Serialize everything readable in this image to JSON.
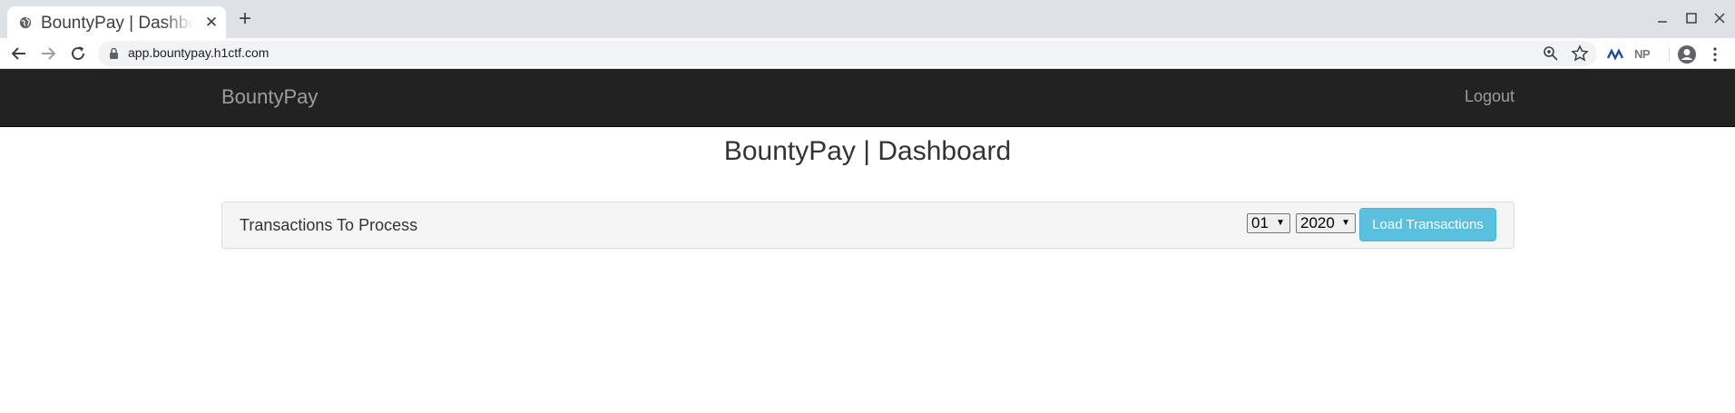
{
  "browser": {
    "tab_title": "BountyPay | Dashboard",
    "url": "app.bountypay.h1ctf.com",
    "extension_np_label": "NP",
    "icons": {
      "favicon": "globe-icon",
      "tab_close": "close-icon",
      "new_tab": "plus-icon",
      "back": "arrow-left-icon",
      "forward": "arrow-right-icon",
      "reload": "reload-icon",
      "lock": "lock-icon",
      "zoom": "zoom-icon",
      "bookmark": "star-icon",
      "profile": "account-circle-icon",
      "menu": "kebab-menu-icon"
    }
  },
  "navbar": {
    "brand": "BountyPay",
    "logout": "Logout"
  },
  "page": {
    "title": "BountyPay | Dashboard"
  },
  "panel": {
    "heading": "Transactions To Process",
    "month_selected": "01",
    "year_selected": "2020",
    "load_button": "Load Transactions"
  },
  "colors": {
    "navbar_bg": "#222222",
    "navbar_text": "#9d9d9d",
    "button_info": "#5bc0de",
    "panel_bg": "#f5f5f5"
  }
}
